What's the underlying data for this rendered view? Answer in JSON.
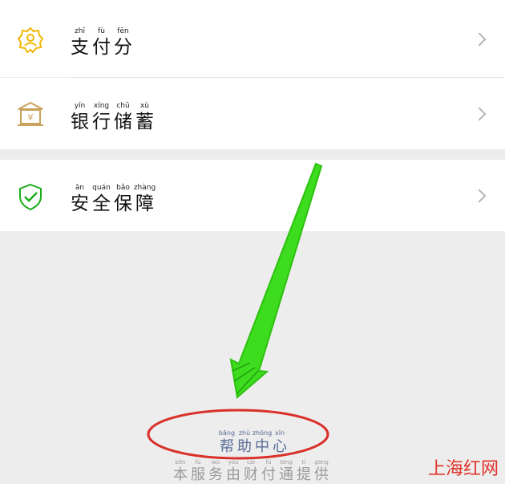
{
  "menu": {
    "items": [
      {
        "icon": "payment-score-icon",
        "chars": [
          [
            "zhī",
            "支"
          ],
          [
            "fù",
            "付"
          ],
          [
            "fēn",
            "分"
          ]
        ]
      },
      {
        "icon": "bank-savings-icon",
        "chars": [
          [
            "yín",
            "银"
          ],
          [
            "xíng",
            "行"
          ],
          [
            "chǔ",
            "储"
          ],
          [
            "xù",
            "蓄"
          ]
        ]
      },
      {
        "icon": "security-shield-icon",
        "chars": [
          [
            "ān",
            "安"
          ],
          [
            "quán",
            "全"
          ],
          [
            "bǎo",
            "保"
          ],
          [
            "zhàng",
            "障"
          ]
        ]
      }
    ]
  },
  "help_center": {
    "chars": [
      [
        "bāng",
        "帮"
      ],
      [
        "zhù",
        "助"
      ],
      [
        "zhōng",
        "中"
      ],
      [
        "xīn",
        "心"
      ]
    ]
  },
  "footer": {
    "chars": [
      [
        "běn",
        "本"
      ],
      [
        "fú",
        "服"
      ],
      [
        "wù",
        "务"
      ],
      [
        "yóu",
        "由"
      ],
      [
        "cái",
        "财"
      ],
      [
        "fù",
        "付"
      ],
      [
        "tōng",
        "通"
      ],
      [
        "tí",
        "提"
      ],
      [
        "gōng",
        "供"
      ]
    ]
  },
  "watermark": "上海红网",
  "colors": {
    "link": "#576b95",
    "annotation_arrow": "#3ddc1f",
    "annotation_circle": "#d9302a"
  }
}
